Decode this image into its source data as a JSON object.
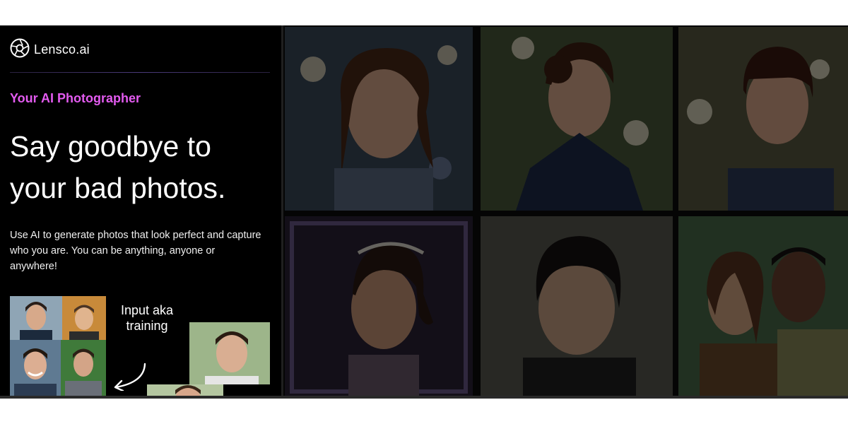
{
  "brand": {
    "name": "Lensco.ai",
    "logo_icon": "aperture-icon"
  },
  "hero": {
    "tagline": "Your AI Photographer",
    "headline_line1": "Say goodbye to",
    "headline_line2": "your bad photos.",
    "description": "Use AI to generate photos that look perfect and capture who you are. You can be anything, anyone or anywhere!"
  },
  "training": {
    "label_line1": "Input aka",
    "label_line2": "training",
    "arrow_icon": "curved-arrow-icon"
  },
  "gallery": {
    "tiles": [
      {
        "subject": "woman-curly-hair-flowers"
      },
      {
        "subject": "woman-updo-dress-flowers"
      },
      {
        "subject": "woman-bangs-flowers"
      },
      {
        "subject": "woman-tiara-ornate-frame"
      },
      {
        "subject": "young-man-portrait"
      },
      {
        "subject": "couple-outdoor"
      }
    ]
  },
  "colors": {
    "accent": "#e35bf0",
    "background": "#000000",
    "text": "#ffffff"
  }
}
